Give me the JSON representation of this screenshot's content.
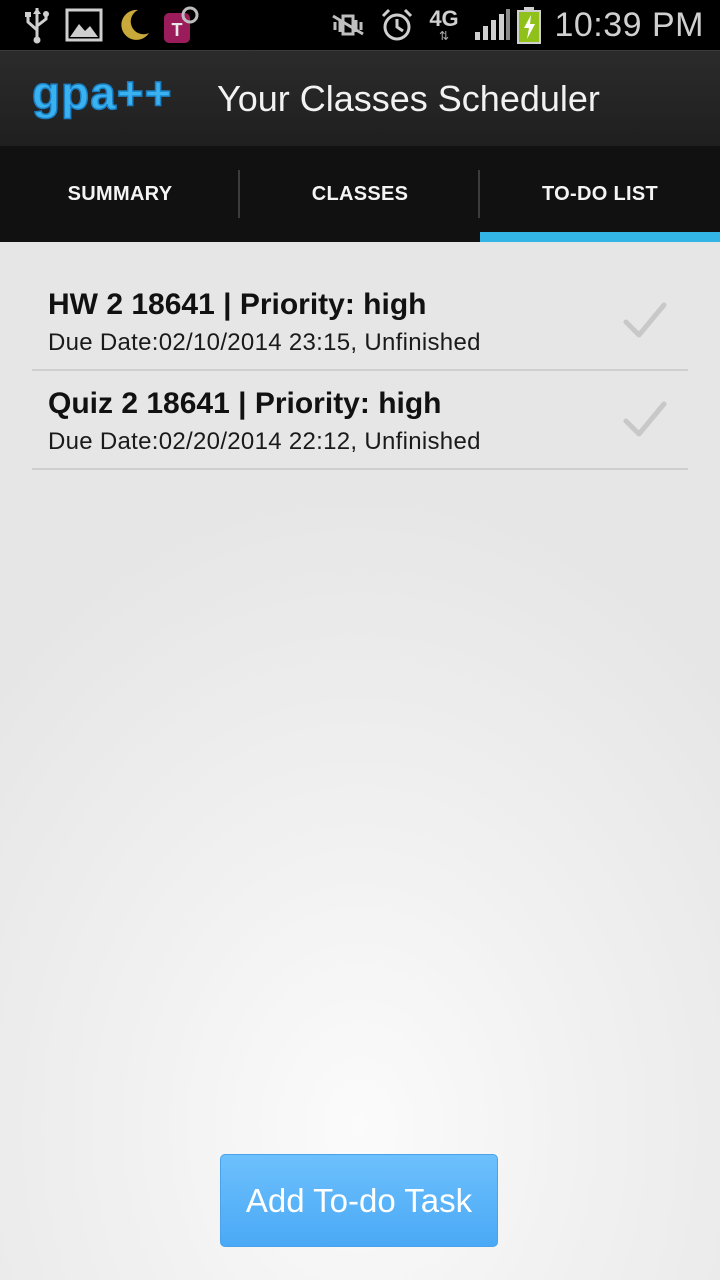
{
  "status_bar": {
    "time": "10:39 PM",
    "network": "4G",
    "carrier_icon_letter": "T",
    "icons": [
      "usb-icon",
      "image-icon",
      "moon-icon",
      "carrier-icon",
      "mute-icon",
      "alarm-icon",
      "4g-icon",
      "signal-icon",
      "battery-icon"
    ]
  },
  "app_bar": {
    "logo_text": "gpa++",
    "title": "Your Classes Scheduler"
  },
  "tabs": [
    {
      "label": "SUMMARY",
      "selected": false
    },
    {
      "label": "CLASSES",
      "selected": false
    },
    {
      "label": "TO-DO LIST",
      "selected": true
    }
  ],
  "todos": [
    {
      "title": "HW 2 18641 | Priority: high",
      "subtitle": "Due Date:02/10/2014 23:15, Unfinished"
    },
    {
      "title": "Quiz 2 18641 | Priority: high",
      "subtitle": "Due Date:02/20/2014 22:12, Unfinished"
    }
  ],
  "add_button": {
    "label": "Add To-do Task"
  },
  "colors": {
    "accent": "#33b5e5",
    "button": "#5cb5f9",
    "app_bar": "#262626",
    "tab_bar": "#111111"
  }
}
